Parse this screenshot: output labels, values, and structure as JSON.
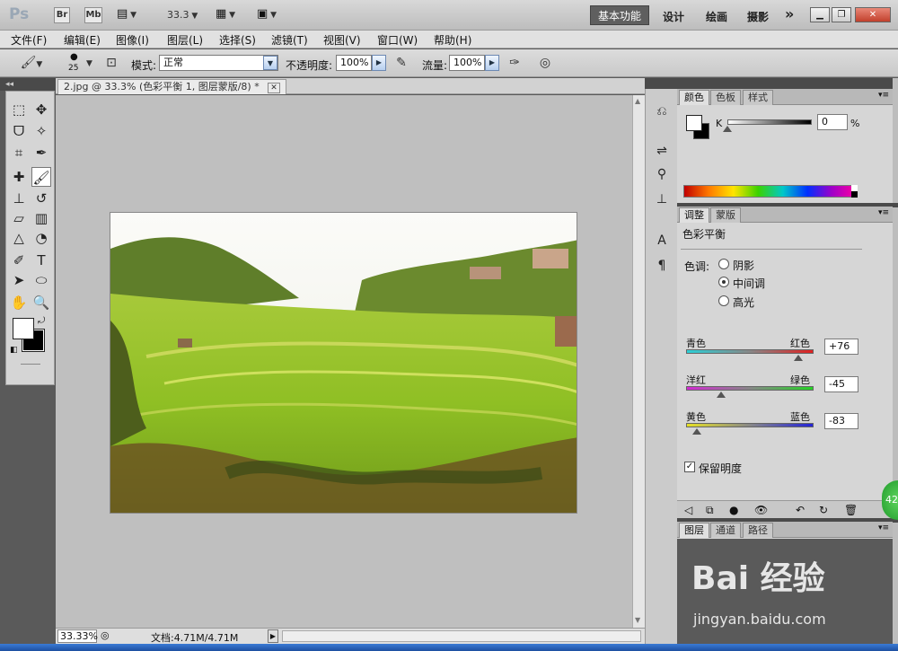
{
  "app": {
    "logo": "Ps",
    "bridge_label": "Br",
    "minibridge_label": "Mb",
    "zoom": "33.3",
    "workspaces": {
      "active": "基本功能",
      "others": [
        "设计",
        "绘画",
        "摄影"
      ],
      "more": "»"
    }
  },
  "menu": [
    "文件(F)",
    "编辑(E)",
    "图像(I)",
    "图层(L)",
    "选择(S)",
    "滤镜(T)",
    "视图(V)",
    "窗口(W)",
    "帮助(H)"
  ],
  "options": {
    "brush_size": "25",
    "mode_label": "模式:",
    "mode_value": "正常",
    "opacity_label": "不透明度:",
    "opacity_value": "100%",
    "flow_label": "流量:",
    "flow_value": "100%"
  },
  "document": {
    "tab_title": "2.jpg @ 33.3% (色彩平衡 1, 图层蒙版/8) *",
    "status_zoom": "33.33%",
    "status_doc": "文档:4.71M/4.71M"
  },
  "color_panel": {
    "tabs": [
      "颜色",
      "色板",
      "样式"
    ],
    "channel_label": "K",
    "value": "0",
    "unit": "%",
    "level": 0
  },
  "adjustments_panel": {
    "tabs": [
      "调整",
      "蒙版"
    ],
    "title": "色彩平衡",
    "tone_label": "色调:",
    "tones": [
      "阴影",
      "中间调",
      "高光"
    ],
    "selected_tone": 1,
    "sliders": [
      {
        "left": "青色",
        "right": "红色",
        "value": "+76",
        "amount": 76,
        "colors": [
          "#2ccfd6",
          "#e02020"
        ]
      },
      {
        "left": "洋红",
        "right": "绿色",
        "value": "-45",
        "amount": -45,
        "colors": [
          "#d22ad2",
          "#25d225"
        ]
      },
      {
        "left": "黄色",
        "right": "蓝色",
        "value": "-83",
        "amount": -83,
        "colors": [
          "#e6e024",
          "#2424d8"
        ]
      }
    ],
    "preserve_luminosity_label": "保留明度",
    "preserve_luminosity": true
  },
  "layers_panel": {
    "tabs": [
      "图层",
      "通道",
      "路径"
    ]
  },
  "overlay": {
    "badge": "42",
    "watermark": "Bai 经验",
    "watermark_sub": "jingyan.baidu.com"
  }
}
